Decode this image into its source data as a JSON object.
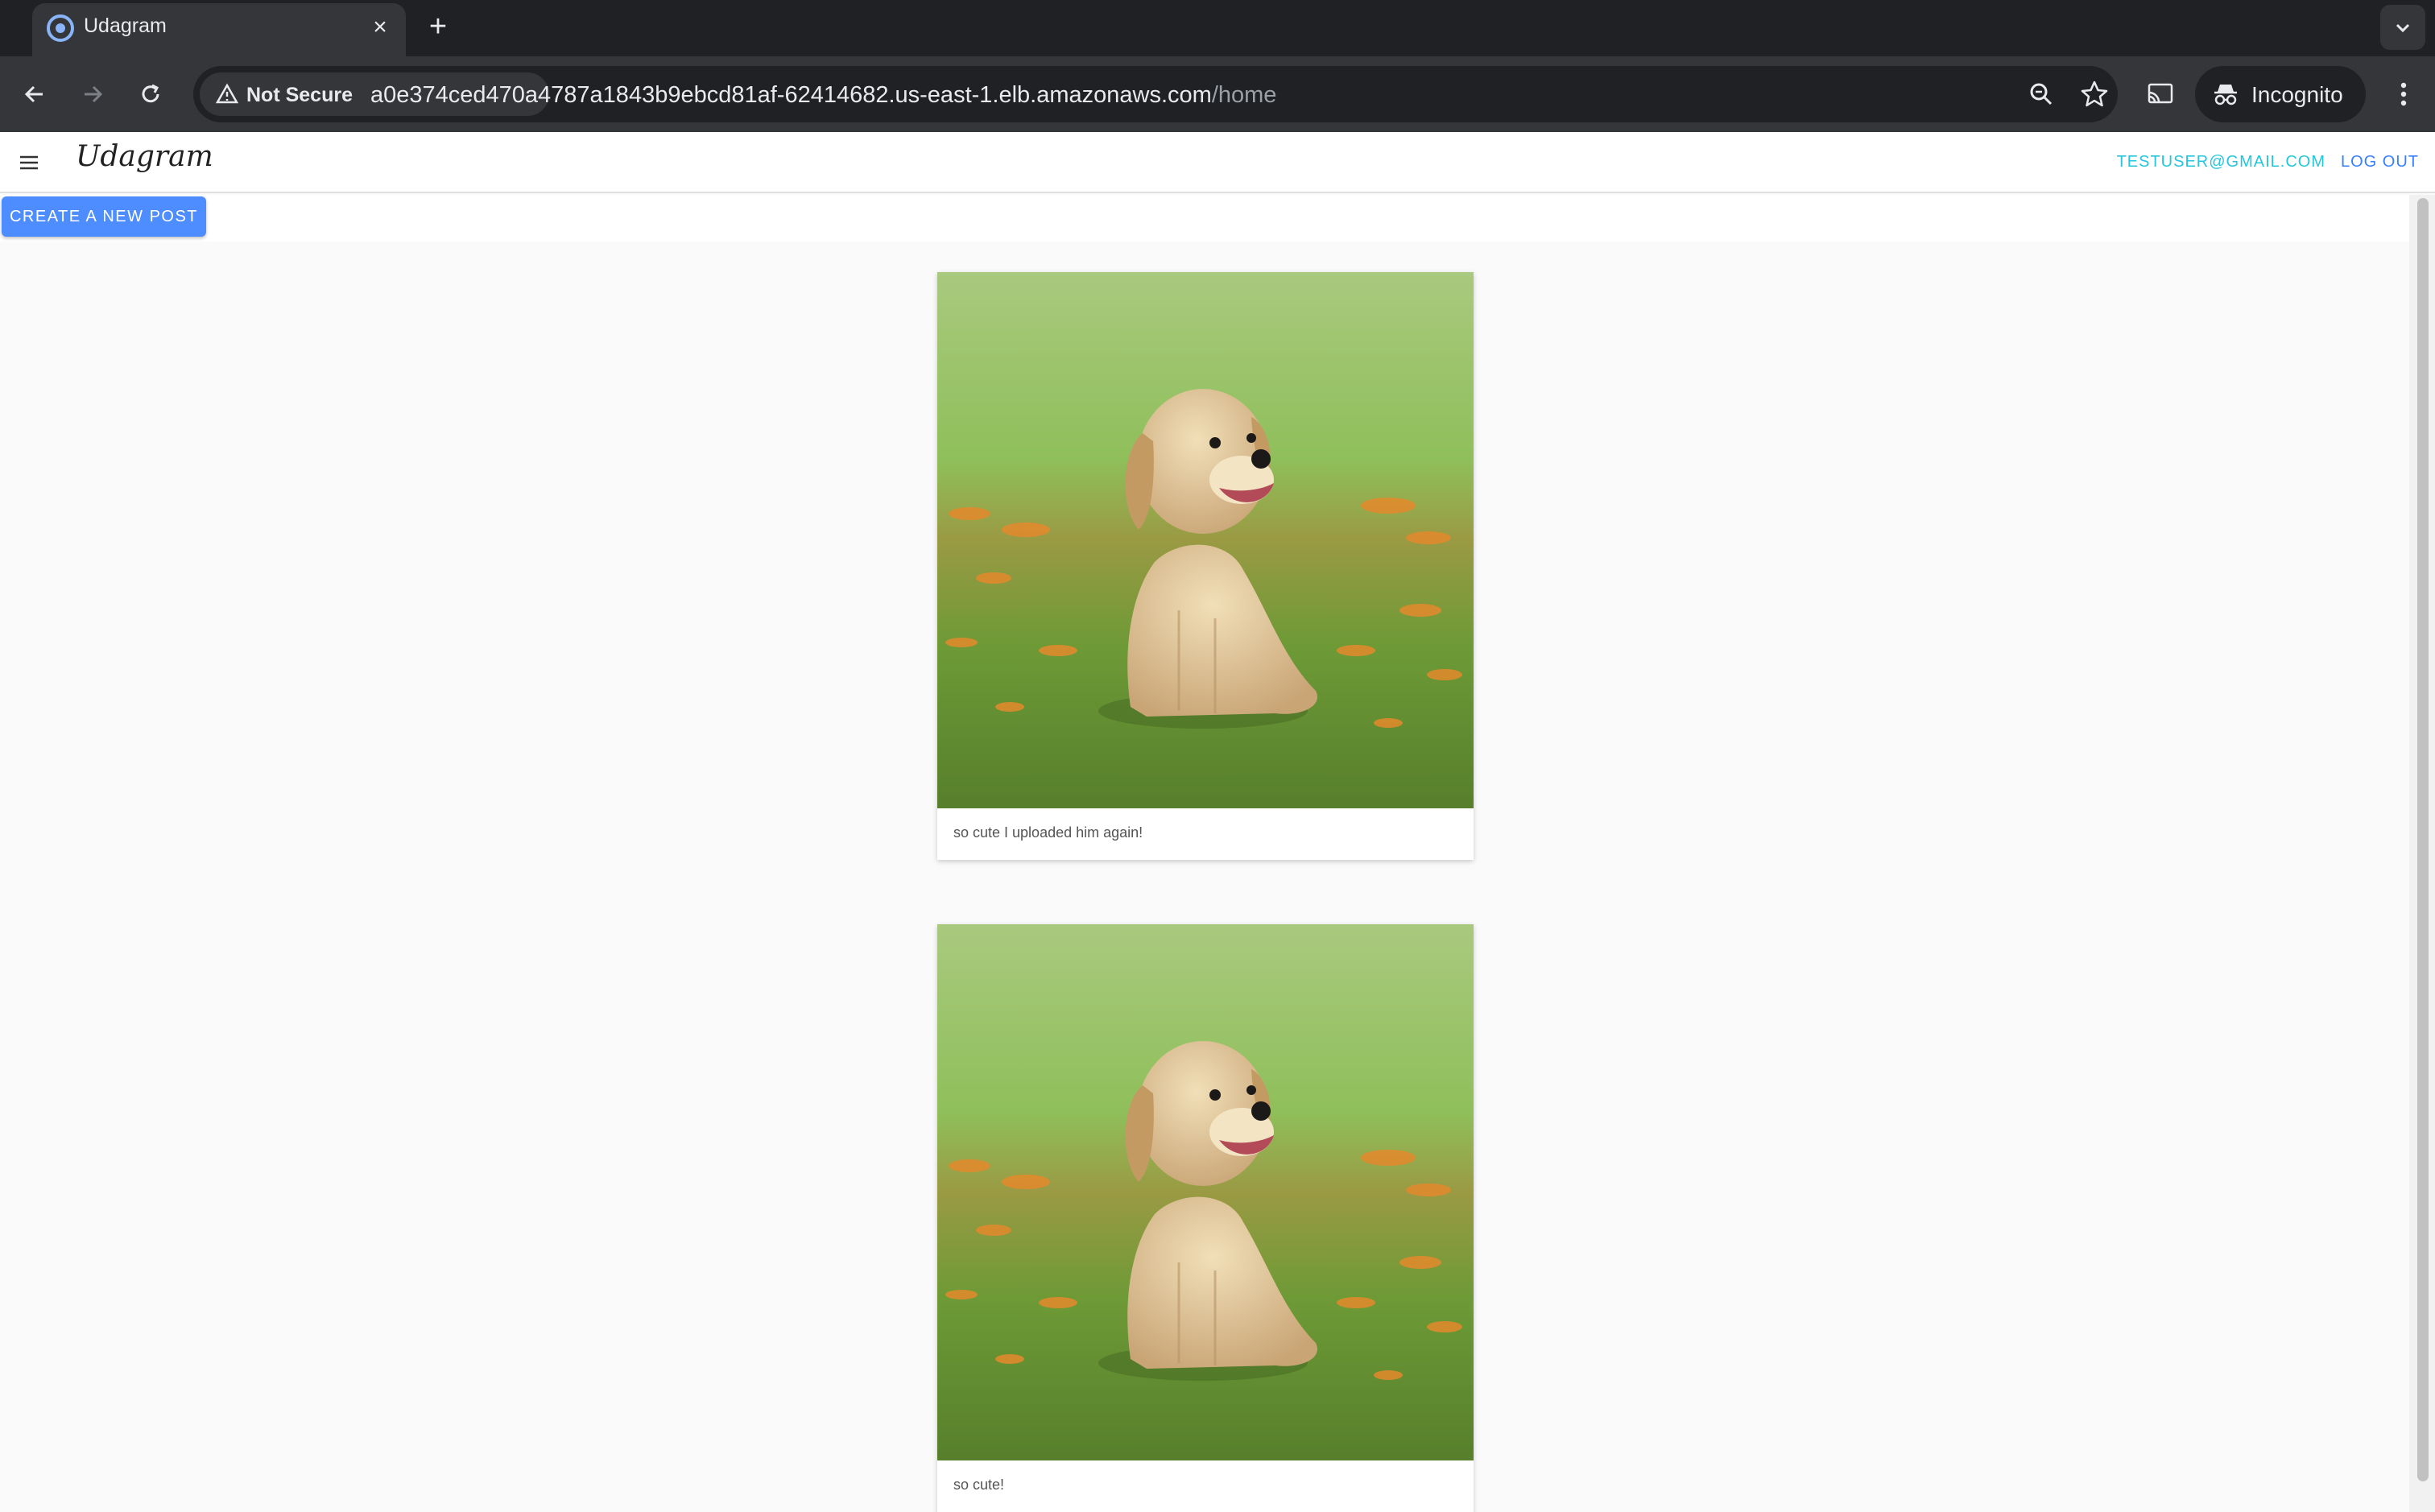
{
  "browser": {
    "tab_title": "Udagram",
    "new_tab": "+",
    "close_tab": "×",
    "security_label": "Not Secure",
    "url_host": "a0e374ced470a4787a1843b9ebcd81af-62414682.us-east-1.elb.amazonaws.com",
    "url_path": "/home",
    "profile_label": "Incognito",
    "accent_color": "#8ab4f8"
  },
  "app": {
    "brand": "Udagram",
    "user_email": "TESTUSER@GMAIL.COM",
    "logout_label": "LOG OUT",
    "create_post_label": "CREATE A NEW POST",
    "primary_color": "#4d8dff"
  },
  "posts": [
    {
      "caption": "so cute I uploaded him again!",
      "image": "golden-retriever-puppy-in-field"
    },
    {
      "caption": "so cute!",
      "image": "golden-retriever-puppy-in-field"
    }
  ]
}
